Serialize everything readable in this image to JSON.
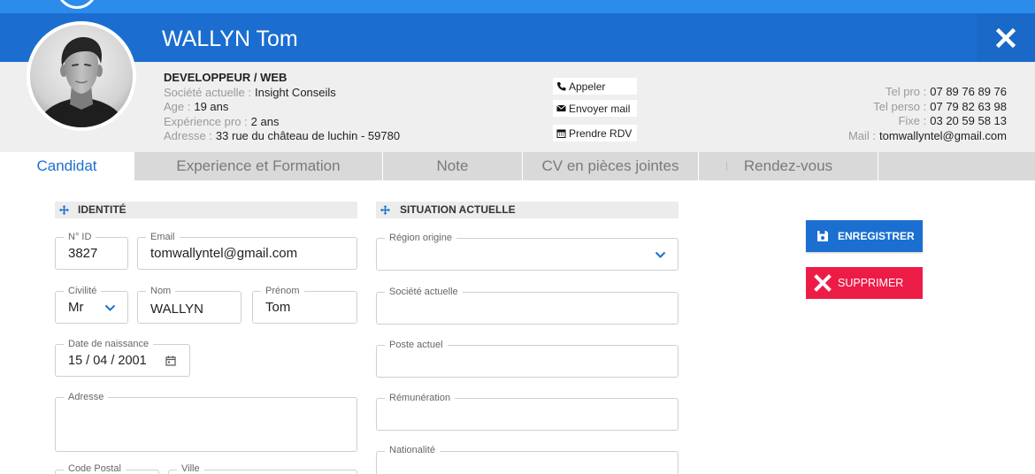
{
  "header": {
    "title": "WALLYN Tom"
  },
  "profile": {
    "job_title": "DEVELOPPEUR / WEB",
    "company_label": "Société actuelle :",
    "company_value": "Insight Conseils",
    "age_label": "Age :",
    "age_value": "19 ans",
    "experience_label": "Expérience pro :",
    "experience_value": "2 ans",
    "address_label": "Adresse :",
    "address_value": "33 rue du château de luchin - 59780"
  },
  "actions": {
    "call": {
      "label": "Appeler",
      "icon": "phone-icon"
    },
    "mail": {
      "label": "Envoyer mail",
      "icon": "envelope-icon"
    },
    "appointment": {
      "label": "Prendre RDV",
      "icon": "calendar-icon"
    }
  },
  "contact": {
    "tel_pro_label": "Tel pro :",
    "tel_pro_value": "07 89 76 89 76",
    "tel_perso_label": "Tel perso :",
    "tel_perso_value": "07 79 82 63 98",
    "fixe_label": "Fixe :",
    "fixe_value": "03 20 59 58 13",
    "mail_label": "Mail :",
    "mail_value": "tomwallyntel@gmail.com"
  },
  "tabs": [
    {
      "label": "Candidat",
      "active": true
    },
    {
      "label": "Experience et Formation",
      "active": false
    },
    {
      "label": "Note",
      "active": false
    },
    {
      "label": "CV en pièces jointes",
      "active": false
    },
    {
      "label": "Rendez-vous",
      "active": false
    }
  ],
  "identity": {
    "title": "IDENTITÉ",
    "icon": "move-icon",
    "id_label": "N° ID",
    "id_value": "3827",
    "email_label": "Email",
    "email_value": "tomwallyntel@gmail.com",
    "civility_label": "Civilité",
    "civility_value": "Mr",
    "lastname_label": "Nom",
    "lastname_value": "WALLYN",
    "firstname_label": "Prénom",
    "firstname_value": "Tom",
    "birthdate_label": "Date de naissance",
    "birthdate_value": "15 / 04 / 2001",
    "address_label": "Adresse",
    "postal_label": "Code Postal",
    "city_label": "Ville"
  },
  "situation": {
    "title": "SITUATION ACTUELLE",
    "icon": "move-icon",
    "region_label": "Région origine",
    "company_label": "Société actuelle",
    "position_label": "Poste actuel",
    "salary_label": "Rémunération",
    "nationality_label": "Nationalité"
  },
  "buttons": {
    "save": {
      "label": "ENREGISTRER",
      "icon": "save-icon"
    },
    "delete": {
      "label": "SUPPRIMER",
      "icon": "close-icon"
    }
  },
  "colors": {
    "header_blue": "#1b6ecf",
    "top_strip_blue": "#2b8cec",
    "accent_blue": "#1a6fd0",
    "danger_red": "#ed1c47",
    "tab_gray": "#d9d9d9",
    "panel_gray": "#efefef"
  }
}
